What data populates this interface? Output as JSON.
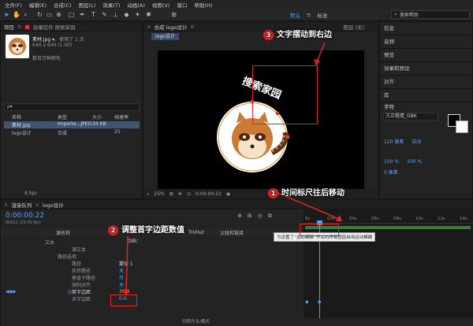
{
  "menu": [
    "文件(F)",
    "编辑(E)",
    "合成(C)",
    "图层(L)",
    "效果(T)",
    "动画(A)",
    "视图(V)",
    "窗口",
    "帮助(H)"
  ],
  "toolbar": {
    "workspace_active": "默认",
    "workspace_menu": "≡",
    "workspace_other": "标准",
    "search_placeholder": "搜索帮助"
  },
  "project": {
    "tab_label": "项目",
    "effect_tab": "效果控件 搜索家园",
    "file_name": "素材.jpg ▾",
    "file_used": "，使用了 1 次",
    "file_dims": "640 x 640 (1.00)",
    "file_info": "数百万种颜色",
    "search_placeholder": "ρ▾",
    "headers": [
      "名称",
      "类型",
      "大小",
      "帧速率"
    ],
    "items": [
      {
        "name": "素材.jpg",
        "type": "Importe...JPEG",
        "size": "34 KB",
        "fps": ""
      },
      {
        "name": "logo设计",
        "type": "合成",
        "size": "",
        "fps": "25"
      }
    ],
    "bpc": "8 bpc"
  },
  "comp": {
    "tab_label": "合成 logo设计",
    "tab_menu": "≡",
    "sub_tab": "logo设计",
    "layer_label": "图层 (无)",
    "zoom": "25%",
    "timecode": "0:00:00:22",
    "logo_text": "搜索家园"
  },
  "right_panel": {
    "items": [
      "信息",
      "音频",
      "预览",
      "效果和预设",
      "对齐",
      "库"
    ],
    "char_title": "字符",
    "font": "方正粗倩_GBK",
    "size": "120 像素",
    "leading": "自动",
    "scale_v": "100 %",
    "scale_h": "100 %",
    "baseline": "0 像素"
  },
  "timeline": {
    "queue_tab": "渲染队列",
    "comp_tab": "logo设计",
    "timecode": "0:00:00:22",
    "frame_rate": "00022 (25.00 fps)",
    "layer_header": "源名称",
    "trkmat": "TrkMat",
    "parent": "父级和链接",
    "anim_label": "动画：",
    "rows": [
      {
        "label": "文本",
        "value": ""
      },
      {
        "label": "源文本",
        "value": ""
      },
      {
        "label": "路径选项",
        "value": ""
      },
      {
        "label": "路径",
        "value": "蒙版 1"
      },
      {
        "label": "反转路径",
        "value": "关"
      },
      {
        "label": "垂直于路径",
        "value": "开"
      },
      {
        "label": "强制对齐",
        "value": "关"
      },
      {
        "label": "首字边距",
        "value": "30.0"
      },
      {
        "label": "末字边距",
        "value": "0.0"
      }
    ],
    "ruler": [
      "0s",
      "02s",
      "04s",
      "06s",
      "08s",
      "10s",
      "12s",
      "14s"
    ],
    "tooltip": "为设置了“运动模糊”开关的所有图层启用运动模糊",
    "switches_bar": "切换开关/模式"
  },
  "callouts": [
    {
      "num": "1",
      "text": "时间标尺往后移动"
    },
    {
      "num": "2",
      "text": "调整首字边距数值"
    },
    {
      "num": "3",
      "text": "文字摆动到右边"
    }
  ],
  "colors": {
    "accent": "#4da3ff",
    "callout": "#e1242a",
    "keyframe": "#4da3ff"
  }
}
